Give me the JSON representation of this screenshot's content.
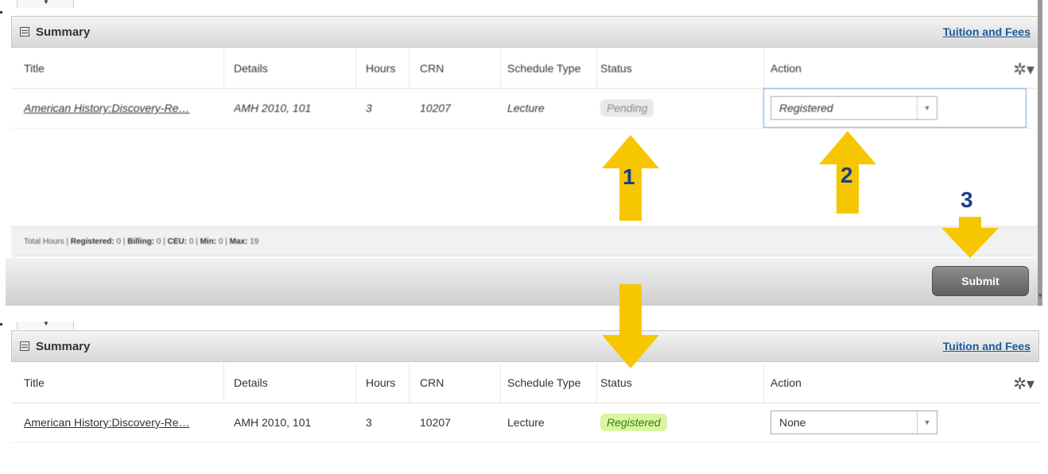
{
  "colors": {
    "arrow": "#f6c700",
    "number": "#1a3d8f",
    "link": "#1d5a9a",
    "registered_bg": "#d8f5a0",
    "registered_text": "#3d7a14"
  },
  "top": {
    "summary_title": "Summary",
    "fees_link": "Tuition and Fees",
    "columns": [
      "Title",
      "Details",
      "Hours",
      "CRN",
      "Schedule Type",
      "Status",
      "Action"
    ],
    "row": {
      "title": "American History:Discovery-Re…",
      "details": "AMH 2010, 101",
      "hours": "3",
      "crn": "10207",
      "schedule_type": "Lecture",
      "status": "Pending",
      "action": "Registered"
    },
    "footer": {
      "label": "Total Hours |",
      "registered_label": "Registered:",
      "registered": "0",
      "billing_label": "Billing:",
      "billing": "0",
      "ceu_label": "CEU:",
      "ceu": "0",
      "min_label": "Min:",
      "min": "0",
      "max_label": "Max:",
      "max": "19"
    },
    "submit": "Submit"
  },
  "bottom": {
    "summary_title": "Summary",
    "fees_link": "Tuition and Fees",
    "columns": [
      "Title",
      "Details",
      "Hours",
      "CRN",
      "Schedule Type",
      "Status",
      "Action"
    ],
    "row": {
      "title": "American History:Discovery-Re…",
      "details": "AMH 2010, 101",
      "hours": "3",
      "crn": "10207",
      "schedule_type": "Lecture",
      "status": "Registered",
      "action": "None"
    }
  },
  "annotations": {
    "step1": "1",
    "step2": "2",
    "step3": "3"
  },
  "icons": {
    "summary": "list-icon",
    "settings": "gear-icon",
    "dropdown": "chevron-down-icon"
  }
}
